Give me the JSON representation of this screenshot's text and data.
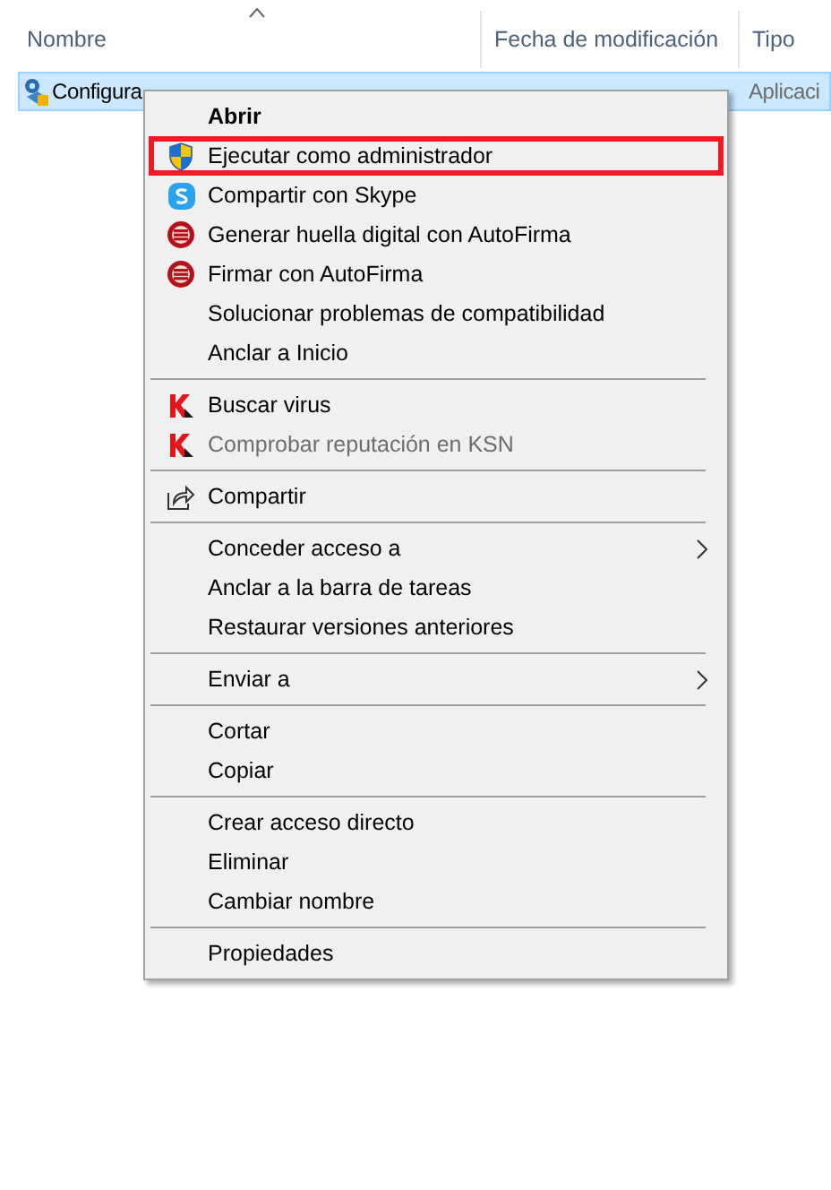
{
  "columns": [
    {
      "label": "Nombre",
      "sorted": true
    },
    {
      "label": "Fecha de modificación",
      "sorted": false
    },
    {
      "label": "Tipo",
      "sorted": false
    }
  ],
  "file": {
    "name": "Configura",
    "type": "Aplicaci",
    "selected": true
  },
  "menu": [
    {
      "kind": "item",
      "label": "Abrir",
      "bold": true,
      "submenu": false,
      "disabled": false,
      "marked": false
    },
    {
      "kind": "item",
      "label": "Ejecutar como administrador",
      "bold": false,
      "submenu": false,
      "disabled": false,
      "marked": true
    },
    {
      "kind": "item",
      "label": "Compartir con Skype",
      "bold": false,
      "submenu": false,
      "disabled": false,
      "marked": false
    },
    {
      "kind": "item",
      "label": "Generar huella digital con AutoFirma",
      "bold": false,
      "submenu": false,
      "disabled": false,
      "marked": false
    },
    {
      "kind": "item",
      "label": "Firmar con AutoFirma",
      "bold": false,
      "submenu": false,
      "disabled": false,
      "marked": false
    },
    {
      "kind": "item",
      "label": "Solucionar problemas de compatibilidad",
      "bold": false,
      "submenu": false,
      "disabled": false,
      "marked": false
    },
    {
      "kind": "item",
      "label": "Anclar a Inicio",
      "bold": false,
      "submenu": false,
      "disabled": false,
      "marked": false
    },
    {
      "kind": "separator"
    },
    {
      "kind": "item",
      "label": "Buscar virus",
      "bold": false,
      "submenu": false,
      "disabled": false,
      "marked": false
    },
    {
      "kind": "item",
      "label": "Comprobar reputación en KSN",
      "bold": false,
      "submenu": false,
      "disabled": true,
      "marked": false
    },
    {
      "kind": "separator"
    },
    {
      "kind": "item",
      "label": "Compartir",
      "bold": false,
      "submenu": false,
      "disabled": false,
      "marked": false
    },
    {
      "kind": "separator"
    },
    {
      "kind": "item",
      "label": "Conceder acceso a",
      "bold": false,
      "submenu": true,
      "disabled": false,
      "marked": false
    },
    {
      "kind": "item",
      "label": "Anclar a la barra de tareas",
      "bold": false,
      "submenu": false,
      "disabled": false,
      "marked": false
    },
    {
      "kind": "item",
      "label": "Restaurar versiones anteriores",
      "bold": false,
      "submenu": false,
      "disabled": false,
      "marked": false
    },
    {
      "kind": "separator"
    },
    {
      "kind": "item",
      "label": "Enviar a",
      "bold": false,
      "submenu": true,
      "disabled": false,
      "marked": false
    },
    {
      "kind": "separator"
    },
    {
      "kind": "item",
      "label": "Cortar",
      "bold": false,
      "submenu": false,
      "disabled": false,
      "marked": false
    },
    {
      "kind": "item",
      "label": "Copiar",
      "bold": false,
      "submenu": false,
      "disabled": false,
      "marked": false
    },
    {
      "kind": "separator"
    },
    {
      "kind": "item",
      "label": "Crear acceso directo",
      "bold": false,
      "submenu": false,
      "disabled": false,
      "marked": false
    },
    {
      "kind": "item",
      "label": "Eliminar",
      "bold": false,
      "submenu": false,
      "disabled": false,
      "marked": false
    },
    {
      "kind": "item",
      "label": "Cambiar nombre",
      "bold": false,
      "submenu": false,
      "disabled": false,
      "marked": false
    },
    {
      "kind": "separator"
    },
    {
      "kind": "item",
      "label": "Propiedades",
      "bold": false,
      "submenu": false,
      "disabled": false,
      "marked": false
    }
  ]
}
